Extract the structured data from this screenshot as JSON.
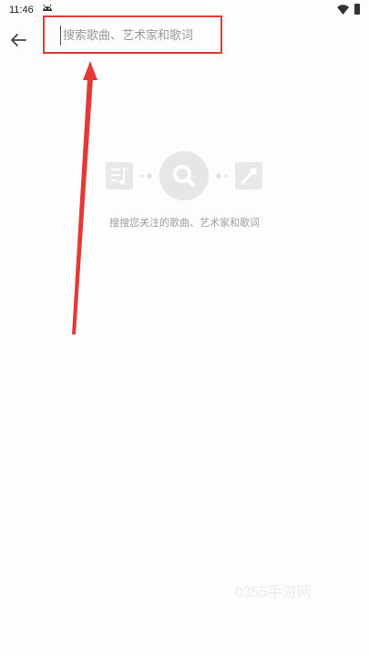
{
  "status_bar": {
    "time": "11:46",
    "icons": [
      "android-robot-icon",
      "wifi-icon",
      "battery-icon"
    ]
  },
  "search": {
    "placeholder": "搜索歌曲、艺术家和歌词",
    "value": "",
    "border_color": "#e53935"
  },
  "empty_state": {
    "hint": "搜搜您关注的歌曲、艺术家和歌词",
    "icons": [
      "music-list-icon",
      "search-icon",
      "microphone-icon"
    ]
  },
  "annotation": {
    "arrow_color": "#e53935"
  },
  "watermark": {
    "text": "0355手游网"
  }
}
